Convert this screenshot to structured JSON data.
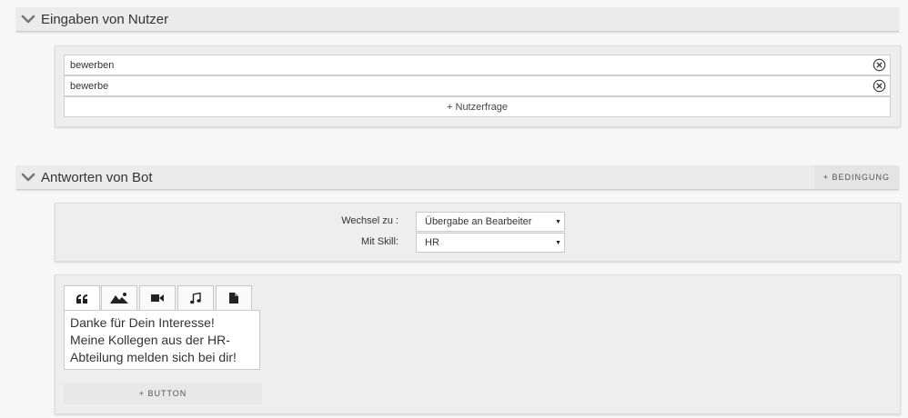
{
  "user_inputs": {
    "title": "Eingaben von Nutzer",
    "entries": [
      {
        "value": "bewerben"
      },
      {
        "value": "bewerbe"
      }
    ],
    "add_label": "+ Nutzerfrage"
  },
  "bot_answers": {
    "title": "Antworten von Bot",
    "condition_label": "+ BEDINGUNG",
    "switch": {
      "label": "Wechsel zu :",
      "value": "Übergabe an Bearbeiter"
    },
    "skill": {
      "label": "Mit Skill:",
      "value": "HR"
    },
    "tabs": [
      {
        "icon": "quote-icon"
      },
      {
        "icon": "image-icon"
      },
      {
        "icon": "video-icon"
      },
      {
        "icon": "music-icon"
      },
      {
        "icon": "file-icon"
      }
    ],
    "message_lines": [
      "Danke für Dein Interesse!",
      "Meine Kollegen aus der HR-",
      "Abteilung melden sich bei dir!"
    ],
    "button_add_label": "+ BUTTON"
  },
  "colors": {
    "page_bg": "#f7f7f7",
    "header_bg": "#ebebeb",
    "panel_bg": "#eeeeee",
    "border": "#cfcfcf"
  }
}
